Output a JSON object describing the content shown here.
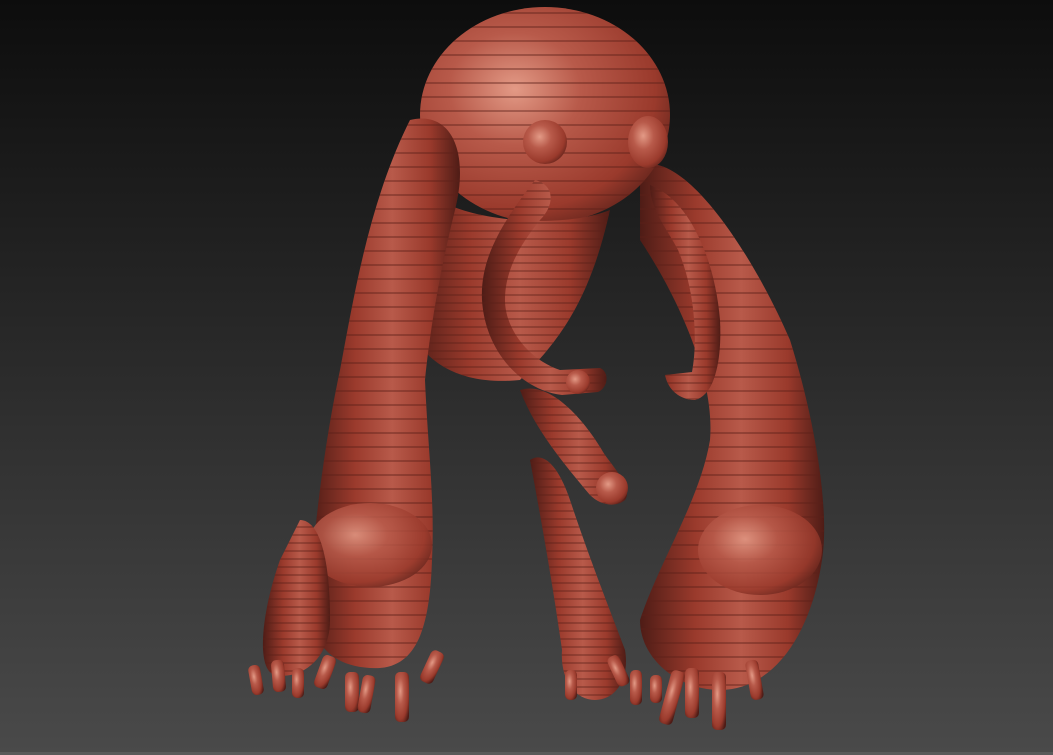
{
  "viewport": {
    "background_top": "#0d0d0d",
    "background_bottom": "#4a4a4a",
    "floor_line": "#5a5a5a"
  },
  "model": {
    "material_base": "#9a3a2c",
    "material_mid": "#b85a4a",
    "material_highlight": "#e39a86",
    "material_shadow": "#4e1c16",
    "ring_stroke": "#6a2a22"
  }
}
